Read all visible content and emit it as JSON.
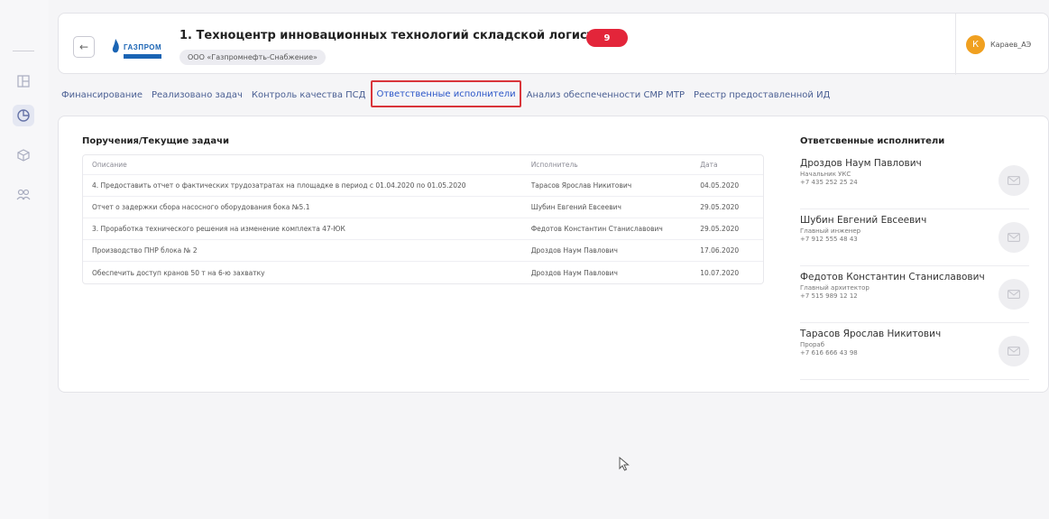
{
  "header": {
    "title": "1. Техноцентр инновационных технологий складской логистики",
    "count": "9",
    "organization": "ООО «Газпромнефть-Снабжение»",
    "logo_text": "ГАЗПРОМ",
    "user_initial": "К",
    "user_name": "Караев_АЭ"
  },
  "tabs": [
    {
      "label": "Финансирование"
    },
    {
      "label": "Реализовано задач"
    },
    {
      "label": "Контроль качества ПСД"
    },
    {
      "label": "Ответственные исполнители",
      "active": true
    },
    {
      "label": "Анализ обеспеченности СМР МТР"
    },
    {
      "label": "Реестр предоставленной ИД"
    }
  ],
  "tasks": {
    "title": "Поручения/Текущие задачи",
    "columns": [
      "Описание",
      "Исполнитель",
      "Дата"
    ],
    "rows": [
      [
        "4. Предоставить отчет о фактических трудозатратах на площадке в период с 01.04.2020 по 01.05.2020",
        "Тарасов Ярослав Никитович",
        "04.05.2020"
      ],
      [
        "Отчет о задержки сбора насосного оборудования бока №5.1",
        "Шубин Евгений Евсеевич",
        "29.05.2020"
      ],
      [
        "3. Проработка технического решения на изменение комплекта 47-ЮК",
        "Федотов Константин Станиславович",
        "29.05.2020"
      ],
      [
        "Производство ПНР блока № 2",
        "Дроздов Наум Павлович",
        "17.06.2020"
      ],
      [
        "Обеспечить доступ кранов 50 т на 6-ю захватку",
        "Дроздов Наум Павлович",
        "10.07.2020"
      ]
    ]
  },
  "people": {
    "title": "Ответсвенные исполнители",
    "items": [
      {
        "name": "Дроздов Наум Павлович",
        "role": "Начальник УКС",
        "phone": "+7 435 252 25 24"
      },
      {
        "name": "Шубин Евгений Евсеевич",
        "role": "Главный инженер",
        "phone": "+7 912 555 48 43"
      },
      {
        "name": "Федотов Константин Станиславович",
        "role": "Главный архитектор",
        "phone": "+7 515 989 12 12"
      },
      {
        "name": "Тарасов Ярослав Никитович",
        "role": "Прораб",
        "phone": "+7 616 666 43 98"
      }
    ]
  },
  "colors": {
    "accent": "#2b56c8",
    "badge": "#e3253a",
    "avatar": "#f0a020",
    "highlight_border": "#d9343a"
  },
  "icons": {
    "back": "arrow-left-icon",
    "rail": [
      "grid-icon",
      "pie-chart-icon",
      "cube-icon",
      "users-icon"
    ],
    "mail": "mail-icon"
  }
}
